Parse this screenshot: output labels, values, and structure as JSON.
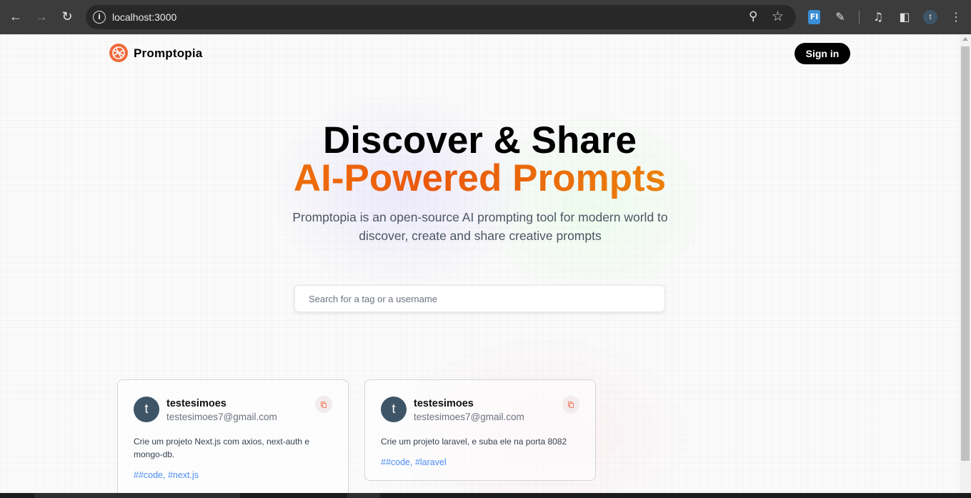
{
  "browser": {
    "url": "localhost:3000",
    "extension_badge": "FI",
    "profile_initial": "t"
  },
  "nav": {
    "logo_text": "Promptopia",
    "signin_label": "Sign in"
  },
  "hero": {
    "title_line1": "Discover & Share",
    "title_line2": "AI-Powered Prompts",
    "description": "Promptopia is an open-source AI prompting tool for modern world to discover, create and share creative prompts"
  },
  "search": {
    "placeholder": "Search for a tag or a username",
    "value": ""
  },
  "prompts": [
    {
      "avatar_initial": "t",
      "username": "testesimoes",
      "email": "testesimoes7@gmail.com",
      "prompt": "Crie um projeto Next.js com axios, next-auth e mongo-db.",
      "tags": "##code, #next.js"
    },
    {
      "avatar_initial": "t",
      "username": "testesimoes",
      "email": "testesimoes7@gmail.com",
      "prompt": "Crie um projeto laravel, e suba ele na porta 8082",
      "tags": "##code, #laravel"
    }
  ],
  "colors": {
    "brand_orange": "#ea580c",
    "gradient_start": "#f59e0b",
    "gradient_end": "#eab308",
    "tag_blue": "#3b82f6"
  },
  "icons": [
    "back-icon",
    "forward-icon",
    "reload-icon",
    "info-icon",
    "zoom-icon",
    "star-icon",
    "extension-icon",
    "media-icon",
    "sidebar-icon",
    "menu-icon",
    "copy-icon"
  ]
}
